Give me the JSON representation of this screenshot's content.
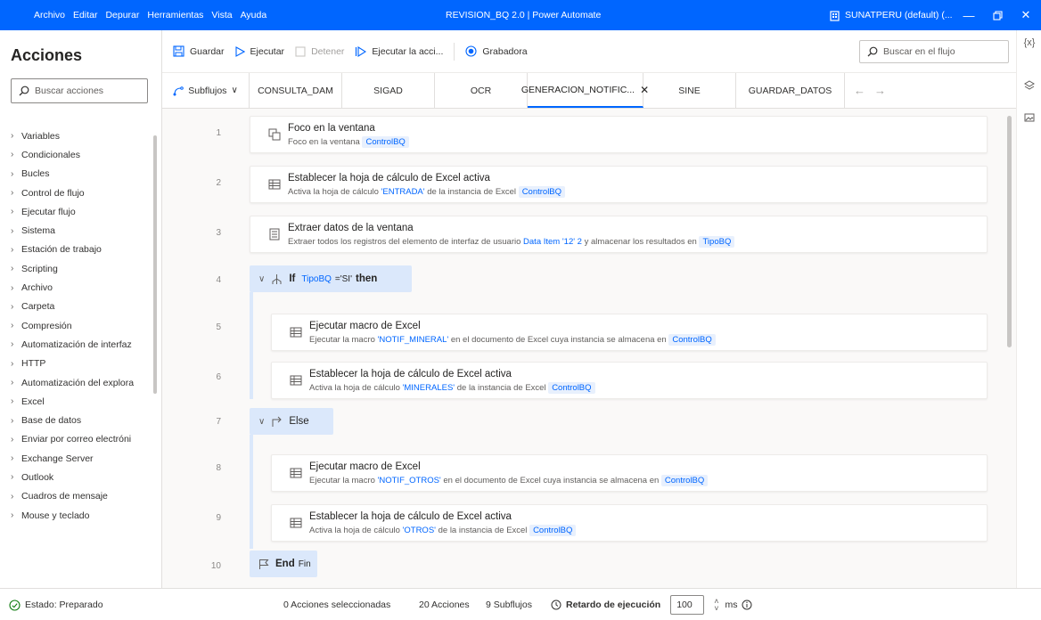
{
  "titlebar": {
    "menu": [
      "Archivo",
      "Editar",
      "Depurar",
      "Herramientas",
      "Vista",
      "Ayuda"
    ],
    "title": "REVISION_BQ 2.0 | Power Automate",
    "account": "SUNATPERU (default) (..."
  },
  "left": {
    "title": "Acciones",
    "search_placeholder": "Buscar acciones",
    "categories": [
      "Variables",
      "Condicionales",
      "Bucles",
      "Control de flujo",
      "Ejecutar flujo",
      "Sistema",
      "Estación de trabajo",
      "Scripting",
      "Archivo",
      "Carpeta",
      "Compresión",
      "Automatización de interfaz",
      "HTTP",
      "Automatización del explora",
      "Excel",
      "Base de datos",
      "Enviar por correo electróni",
      "Exchange Server",
      "Outlook",
      "Cuadros de mensaje",
      "Mouse y teclado"
    ]
  },
  "toolbar": {
    "save": "Guardar",
    "run": "Ejecutar",
    "stop": "Detener",
    "run_action": "Ejecutar la acci...",
    "recorder": "Grabadora",
    "search_flow": "Buscar en el flujo"
  },
  "tabs": {
    "subflows": "Subflujos",
    "items": [
      "CONSULTA_DAM",
      "SIGAD",
      "OCR",
      "GENERACION_NOTIFIC...",
      "SINE",
      "GUARDAR_DATOS"
    ],
    "active_index": 3
  },
  "rail": {
    "variables": "{x}"
  },
  "flow": {
    "line_numbers": [
      "1",
      "2",
      "3",
      "4",
      "5",
      "6",
      "7",
      "8",
      "9",
      "10"
    ],
    "a1": {
      "title": "Foco en la ventana",
      "d1": "Foco en la ventana",
      "var": "ControlBQ"
    },
    "a2": {
      "title": "Establecer la hoja de cálculo de Excel activa",
      "d1": "Activa la hoja de cálculo",
      "sheet": "'ENTRADA'",
      "d2": "de la instancia de Excel",
      "var": "ControlBQ"
    },
    "a3": {
      "title": "Extraer datos de la ventana",
      "d1": "Extraer todos los registros del elemento de interfaz de usuario",
      "elem": "Data Item '12' 2",
      "d2": "y almacenar los resultados en",
      "var": "TipoBQ"
    },
    "if": {
      "kw": "If",
      "var": "TipoBQ",
      "cond": "='SI'",
      "then": "then"
    },
    "a5": {
      "title": "Ejecutar macro de Excel",
      "d1": "Ejecutar la macro",
      "macro": "'NOTIF_MINERAL'",
      "d2": "en el documento de Excel cuya instancia se almacena en",
      "var": "ControlBQ"
    },
    "a6": {
      "title": "Establecer la hoja de cálculo de Excel activa",
      "d1": "Activa la hoja de cálculo",
      "sheet": "'MINERALES'",
      "d2": "de la instancia de Excel",
      "var": "ControlBQ"
    },
    "else": {
      "kw": "Else"
    },
    "a8": {
      "title": "Ejecutar macro de Excel",
      "d1": "Ejecutar la macro",
      "macro": "'NOTIF_OTROS'",
      "d2": "en el documento de Excel cuya instancia se almacena en",
      "var": "ControlBQ"
    },
    "a9": {
      "title": "Establecer la hoja de cálculo de Excel activa",
      "d1": "Activa la hoja de cálculo",
      "sheet": "'OTROS'",
      "d2": "de la instancia de Excel",
      "var": "ControlBQ"
    },
    "end": {
      "kw": "End",
      "label": "Fin"
    }
  },
  "status": {
    "state": "Estado: Preparado",
    "selected": "0 Acciones seleccionadas",
    "actions": "20 Acciones",
    "subflows": "9 Subflujos",
    "delay_label": "Retardo de ejecución",
    "delay_value": "100",
    "unit": "ms"
  }
}
